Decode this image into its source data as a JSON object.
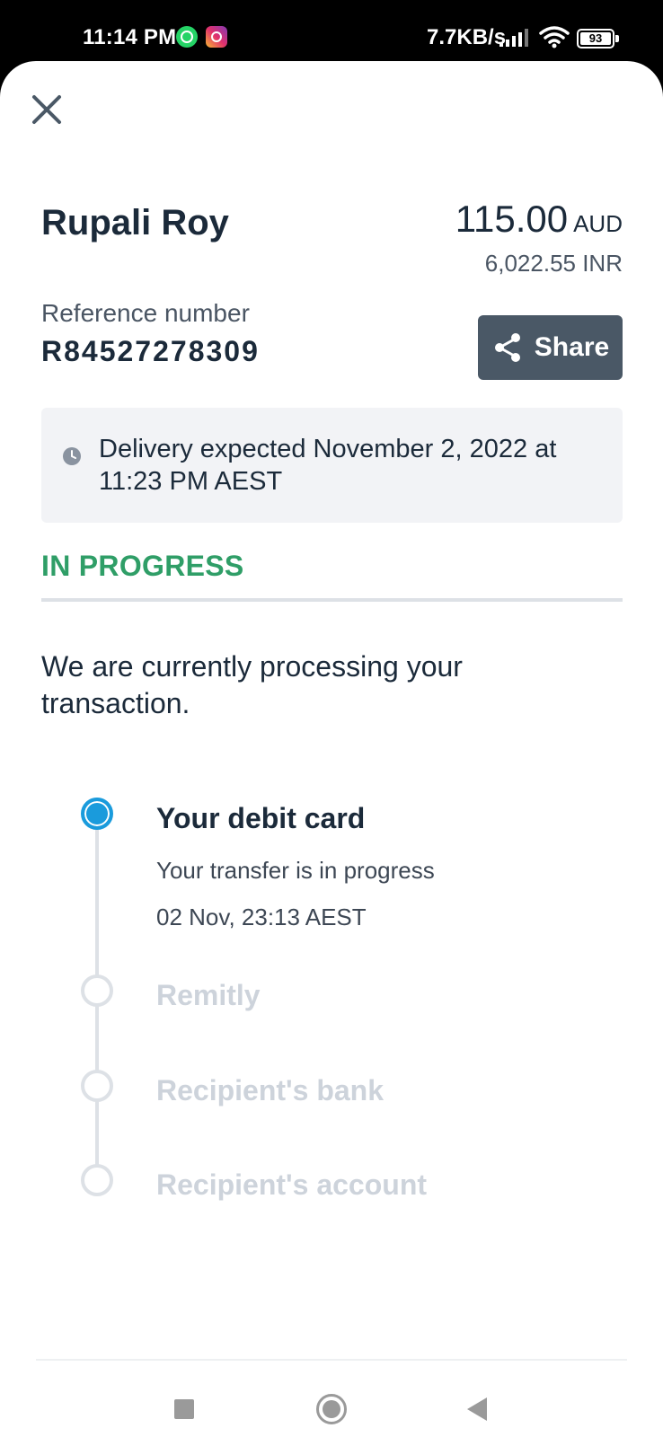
{
  "status_bar": {
    "time": "11:14 PM",
    "net_speed": "7.7KB/s",
    "battery": "93",
    "icons": [
      "whatsapp-icon",
      "instagram-icon",
      "signal-icon",
      "wifi-icon",
      "battery-icon"
    ]
  },
  "transfer": {
    "recipient_name": "Rupali Roy",
    "amount": "115.00",
    "currency": "AUD",
    "converted_amount": "6,022.55 INR",
    "reference_label": "Reference number",
    "reference_number": "R84527278309",
    "share_label": "Share",
    "delivery_text": "Delivery expected November 2, 2022 at 11:23 PM AEST"
  },
  "status": {
    "heading": "IN PROGRESS",
    "heading_color": "#2f9e67",
    "message": "We are currently processing your transaction."
  },
  "timeline": {
    "steps": [
      {
        "title": "Your debit card",
        "subtitle": "Your transfer is in progress",
        "timestamp": "02 Nov, 23:13 AEST",
        "state": "active"
      },
      {
        "title": "Remitly",
        "state": "pending"
      },
      {
        "title": "Recipient's bank",
        "state": "pending"
      },
      {
        "title": "Recipient's account",
        "state": "pending"
      }
    ],
    "active_color": "#1a9bdc"
  },
  "nav_bar": {
    "icons": [
      "recents-square-icon",
      "home-circle-icon",
      "back-triangle-icon"
    ]
  }
}
